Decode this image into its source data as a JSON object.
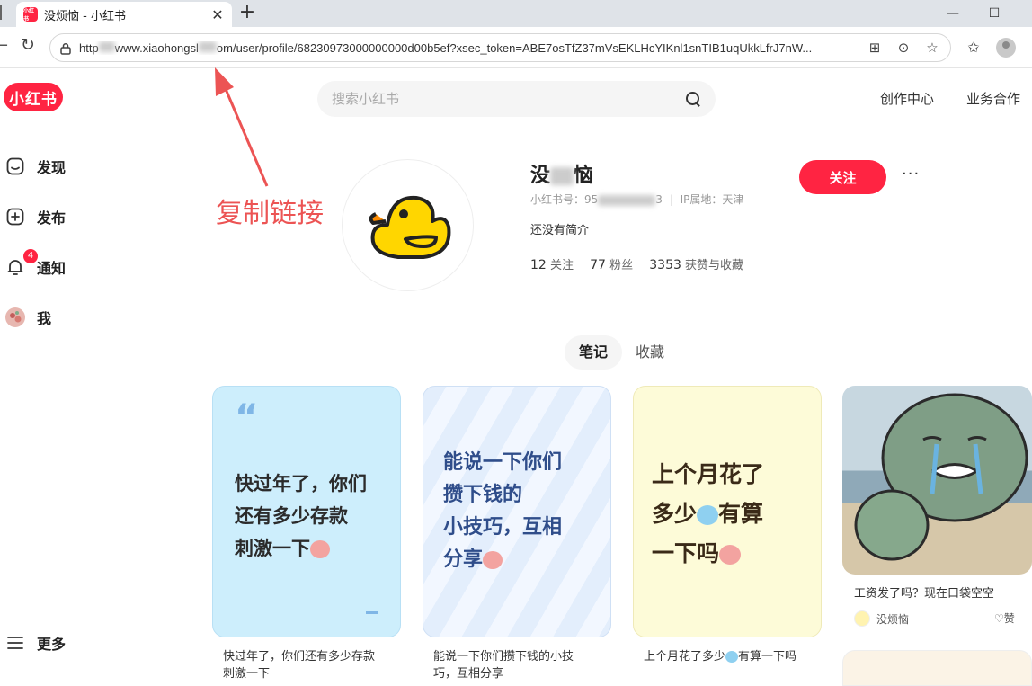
{
  "browser": {
    "tab_title": "没烦恼 - 小红书",
    "tab_favicon_text": "小红书",
    "url": "https://www.xiaohongshu.com/user/profile/68230973000000000d00b5ef?xsec_token=ABE7osTfZ37mVsEKLHcYIKnl1snTIB1uqUkkLfrJ7nW...",
    "url_prefix": "http",
    "url_mid": "www.xiaohongsl",
    "url_rest": "om/user/profile/68230973000000000d00b5ef?xsec_token=ABE7osTfZ37mVsEKLHcYIKnl1snTIB1uqUkkLfrJ7nW...",
    "new_tab": "+",
    "minimize": "—",
    "maximize": "☐",
    "close": "✕"
  },
  "header": {
    "logo": "小红书",
    "search_placeholder": "搜索小红书",
    "links": [
      "创作中心",
      "业务合作"
    ]
  },
  "sidebar": {
    "items": [
      {
        "label": "发现",
        "icon": "discover-icon"
      },
      {
        "label": "发布",
        "icon": "plus-circle-icon"
      },
      {
        "label": "通知",
        "icon": "bell-icon",
        "badge": "4"
      },
      {
        "label": "我",
        "icon": "avatar"
      }
    ],
    "more": "更多"
  },
  "profile": {
    "nickname_start": "没",
    "nickname_end": "恼",
    "id_label": "小红书号：95",
    "id_end": "3",
    "ip_label": "IP属地：天津",
    "bio": "还没有简介",
    "following_count": "12",
    "following_label": "关注",
    "followers_count": "77",
    "followers_label": "粉丝",
    "likes_count": "3353",
    "likes_label": "获赞与收藏",
    "follow_button": "关注",
    "more": "···"
  },
  "tabs": {
    "notes": "笔记",
    "favorites": "收藏"
  },
  "annotation": {
    "text": "复制链接",
    "color": "#ec5454"
  },
  "cards": [
    {
      "line1": "快过年了，你们",
      "line2": "还有多少存款",
      "line3": "刺激一下",
      "quote": "“",
      "title_line1": "快过年了，你们还有多少存款",
      "title_line2": "刺激一下"
    },
    {
      "line1": "能说一下你们",
      "line2": "攒下钱的",
      "line3": "小技巧，互相",
      "line4": "分享",
      "title_line1": "能说一下你们攒下钱的小技",
      "title_line2": "巧，互相分享"
    },
    {
      "line1": "上个月花了",
      "line2": "多少",
      "line2b": "有算",
      "line3": "一下吗",
      "title_line1": "上个月花了多少",
      "title_line1b": "有算一下吗"
    },
    {
      "title": "工资发了吗？现在口袋空空",
      "author": "没烦恼",
      "like": "赞"
    }
  ],
  "colors": {
    "brand": "#ff2442",
    "annotation": "#ec5454"
  }
}
